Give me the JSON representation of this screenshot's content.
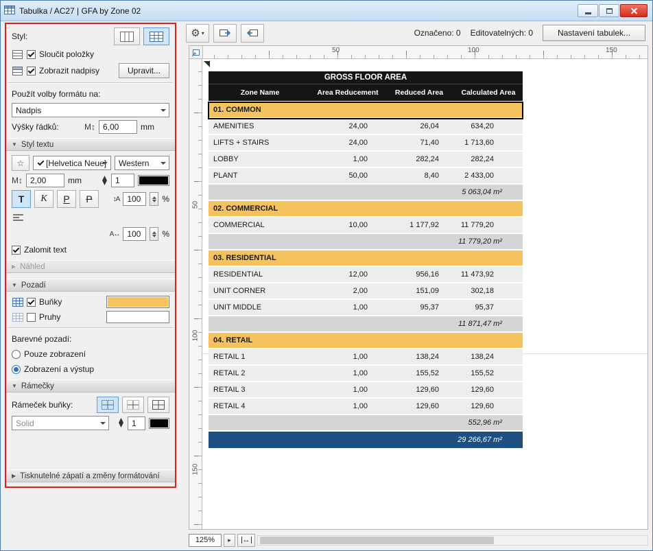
{
  "window": {
    "title": "Tabulka / AC27 | GFA by Zone 02"
  },
  "icons": {
    "gear": "⚙",
    "dropdown": "▾",
    "star": "☆",
    "m_height": "M↕",
    "line_spacing": "↕A",
    "char_width": "↔A",
    "char_spacing": "A↔",
    "play": "▸",
    "fit": "↔",
    "open": "▼",
    "closed": "▶"
  },
  "panel": {
    "style_label": "Styl:",
    "merge_items_label": "Sloučit položky",
    "show_headers_label": "Zobrazit nadpisy",
    "edit_button_label": "Upravit...",
    "apply_format_label": "Použít volby formátu na:",
    "format_target_value": "Nadpis",
    "row_heights_label": "Výšky řádků:",
    "row_height_value": "6,00",
    "row_height_unit": "mm",
    "sections": {
      "text_style": "Styl textu",
      "preview": "Náhled",
      "background": "Pozadí",
      "frames": "Rámečky",
      "footer": "Tisknutelné zápatí a změny formátování"
    },
    "font_family_value": "[Helvetica Neue]",
    "font_script_value": "Western",
    "text_size_value": "2,00",
    "text_size_unit": "mm",
    "text_pen_value": "1",
    "style_bold": "T",
    "style_italic": "K",
    "style_underline": "P",
    "style_strike": "P",
    "line_spacing_value": "100",
    "char_width_value": "100",
    "char_spacing_value": "100",
    "percent": "%",
    "wrap_text_label": "Zalomit text",
    "cells_label": "Buňky",
    "stripes_label": "Pruhy",
    "colored_bg_label": "Barevné pozadí:",
    "radio_display_only": "Pouze zobrazení",
    "radio_display_output": "Zobrazení a výstup",
    "cell_frame_label": "Rámeček buňky:",
    "frame_line_type": "Solid",
    "frame_pen_value": "1",
    "colors": {
      "text_pen": "#000000",
      "cells_bg": "#f8c35f",
      "stripes_bg": "#ffffff",
      "frame_pen": "#000000"
    }
  },
  "toolbar": {
    "selected_count": "Označeno: 0",
    "editable_count": "Editovatelných: 0",
    "settings_button": "Nastavení tabulek..."
  },
  "rulers": {
    "horizontal": [
      "50",
      "100",
      "150"
    ],
    "vertical": [
      "50",
      "100",
      "150"
    ]
  },
  "statusbar": {
    "zoom": "125%"
  },
  "schedule": {
    "title": "GROSS FLOOR AREA",
    "columns": [
      "Zone Name",
      "Area Reducement",
      "Reduced Area",
      "Calculated Area"
    ],
    "groups": [
      {
        "name": "01. COMMON",
        "rows": [
          [
            "AMENITIES",
            "24,00",
            "26,04",
            "634,20"
          ],
          [
            "LIFTS + STAIRS",
            "24,00",
            "71,40",
            "1 713,60"
          ],
          [
            "LOBBY",
            "1,00",
            "282,24",
            "282,24"
          ],
          [
            "PLANT",
            "50,00",
            "8,40",
            "2 433,00"
          ]
        ],
        "subtotal": "5 063,04 m²"
      },
      {
        "name": "02. COMMERCIAL",
        "rows": [
          [
            "COMMERCIAL",
            "10,00",
            "1 177,92",
            "11 779,20"
          ]
        ],
        "subtotal": "11 779,20 m²"
      },
      {
        "name": "03. RESIDENTIAL",
        "rows": [
          [
            "RESIDENTIAL",
            "12,00",
            "956,16",
            "11 473,92"
          ],
          [
            "UNIT CORNER",
            "2,00",
            "151,09",
            "302,18"
          ],
          [
            "UNIT MIDDLE",
            "1,00",
            "95,37",
            "95,37"
          ]
        ],
        "subtotal": "11 871,47 m²"
      },
      {
        "name": "04. RETAIL",
        "rows": [
          [
            "RETAIL 1",
            "1,00",
            "138,24",
            "138,24"
          ],
          [
            "RETAIL 2",
            "1,00",
            "155,52",
            "155,52"
          ],
          [
            "RETAIL 3",
            "1,00",
            "129,60",
            "129,60"
          ],
          [
            "RETAIL 4",
            "1,00",
            "129,60",
            "129,60"
          ]
        ],
        "subtotal": "552,96 m²"
      }
    ],
    "grand_total": "29 266,67 m²",
    "colors": {
      "header_bg": "#151515",
      "zone_bg": "#f5c35e",
      "data_bg": "#ededed",
      "subtotal_bg": "#d6d6d6",
      "total_bg": "#1d4f80",
      "row_sep": "#ffffff"
    }
  }
}
